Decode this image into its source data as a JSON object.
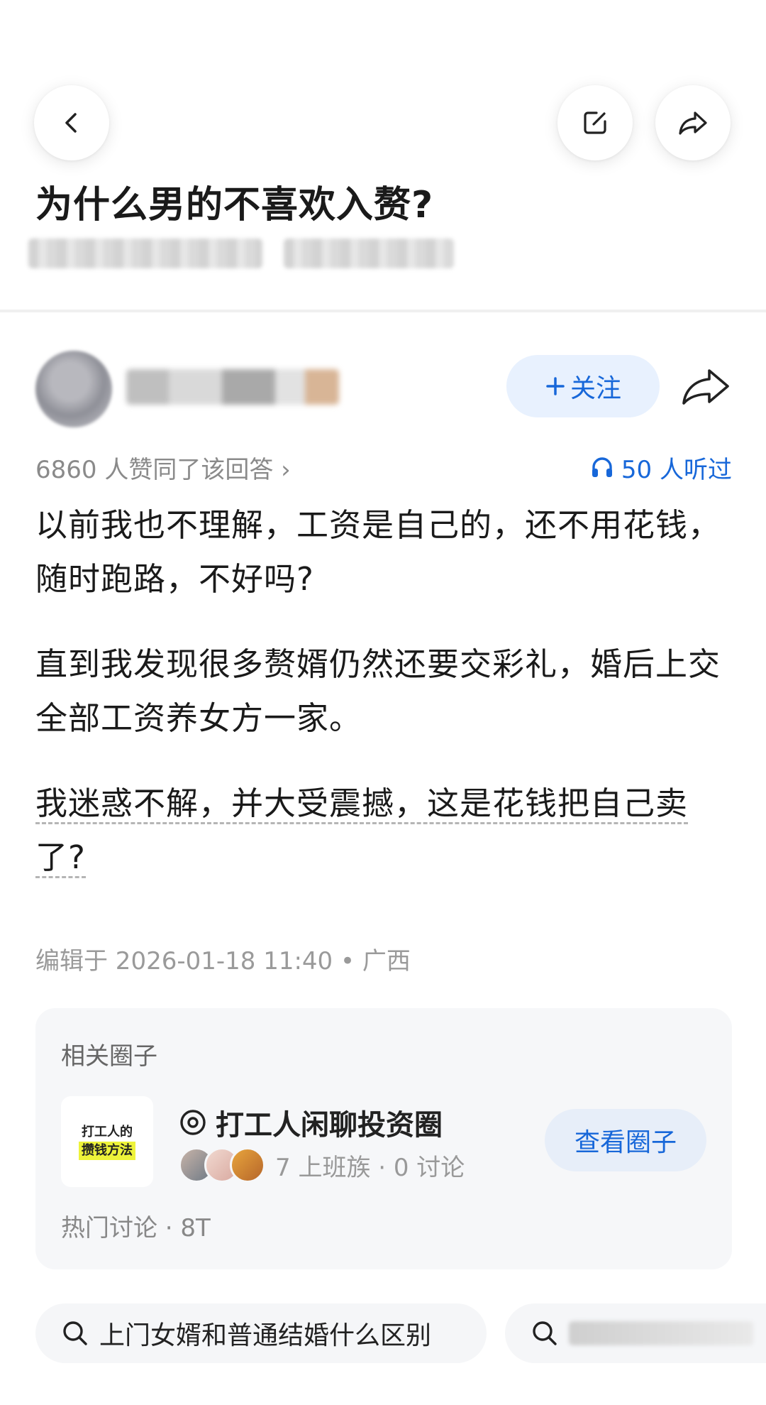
{
  "header": {
    "back_icon": "chevron-left-icon",
    "edit_icon": "edit-icon",
    "share_icon": "share-arrow-icon"
  },
  "question": {
    "title": "为什么男的不喜欢入赘?"
  },
  "answer": {
    "follow_label": "关注",
    "follow_icon": "plus-icon",
    "agree_text": "6860 人赞同了该回答 ›",
    "listen_icon": "headphones-icon",
    "listen_text": "50 人听过",
    "paragraphs": [
      "以前我也不理解，工资是自己的，还不用花钱，随时跑路，不好吗?",
      "直到我发现很多赘婿仍然还要交彩礼，婚后上交全部工资养女方一家。",
      "我迷惑不解，并大受震撼，这是花钱把自己卖了?"
    ],
    "edit_info": "编辑于 2026-01-18 11:40 • 广西"
  },
  "related_circle": {
    "label": "相关圈子",
    "logo_line1": "打工人的",
    "logo_line2": "攒钱方法",
    "name": "打工人闲聊投资圈",
    "stats": "7 上班族 · 0 讨论",
    "view_label": "查看圈子",
    "hot": "热门讨论 · 8T",
    "accent": "#1767d9"
  },
  "related_search": {
    "chips": [
      "上门女婿和普通结婚什么区别"
    ]
  }
}
